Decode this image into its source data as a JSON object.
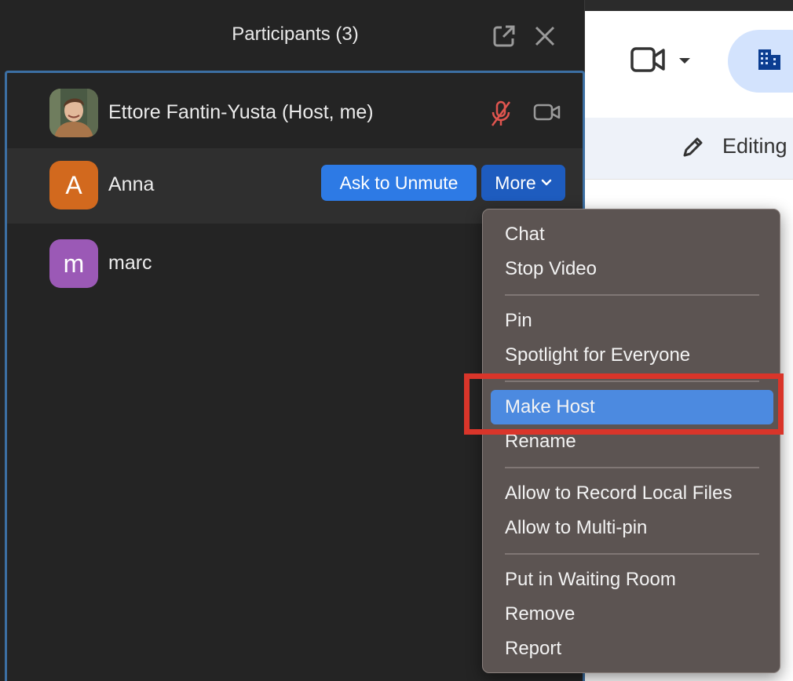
{
  "background_app": {
    "editing_label": "Editing"
  },
  "panel": {
    "title": "Participants (3)"
  },
  "participants": [
    {
      "name": "Ettore Fantin-Yusta (Host, me)",
      "avatar_initial": "",
      "muted": true
    },
    {
      "name": "Anna",
      "avatar_initial": "A",
      "avatar_color": "#d2691e"
    },
    {
      "name": "marc",
      "avatar_initial": "m",
      "avatar_color": "#9b59b6"
    }
  ],
  "actions": {
    "ask_to_unmute": "Ask to Unmute",
    "more": "More"
  },
  "menu": {
    "items": [
      "Chat",
      "Stop Video",
      "Pin",
      "Spotlight for Everyone",
      "Make Host",
      "Rename",
      "Allow to Record Local Files",
      "Allow to Multi-pin",
      "Put in Waiting Room",
      "Remove",
      "Report"
    ],
    "highlighted_item": "Make Host"
  },
  "colors": {
    "accent": "#2d7ae5",
    "highlight": "#4c8ae0",
    "annotation": "#d9352a",
    "muted_mic": "#e0554f"
  }
}
